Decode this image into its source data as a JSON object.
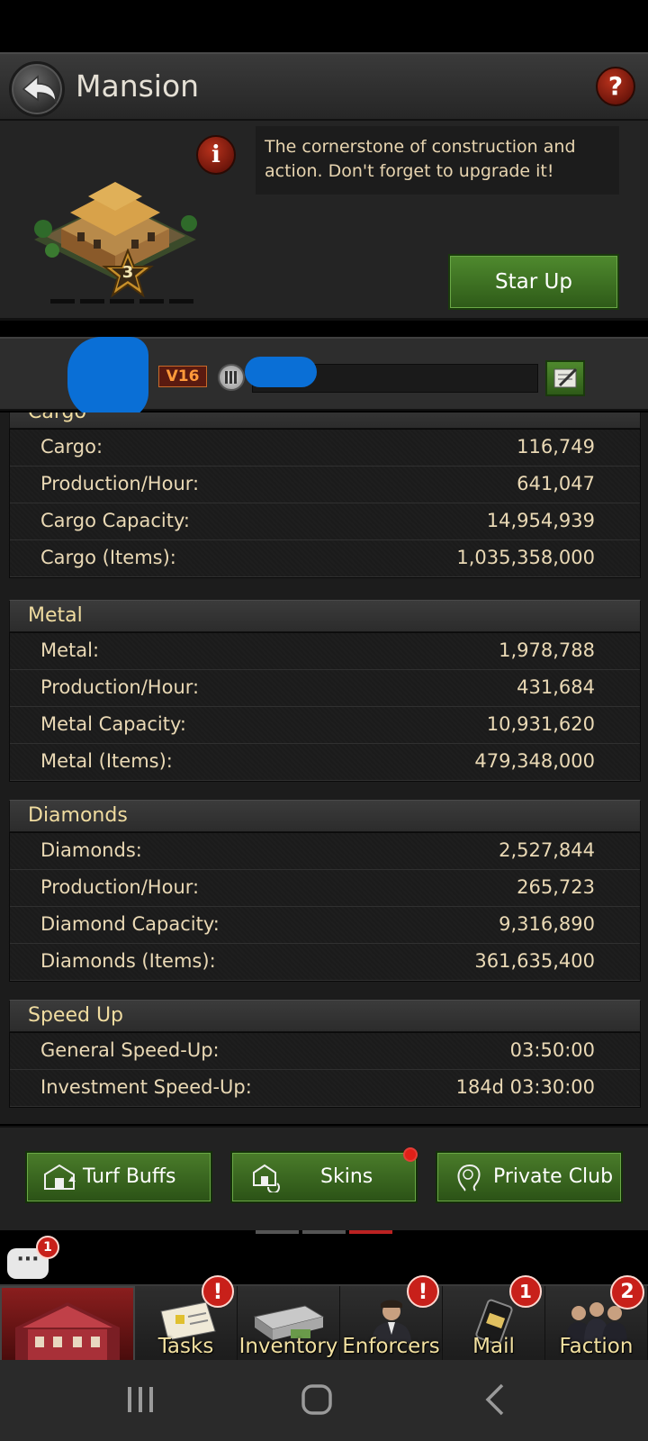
{
  "header": {
    "title": "Mansion",
    "help_label": "?"
  },
  "info": {
    "info_icon_label": "i",
    "description": "The cornerstone of construction and action. Don't forget to upgrade it!",
    "star_level": "3",
    "star_up_label": "Star Up"
  },
  "player": {
    "vip_label": "V16"
  },
  "sections": [
    {
      "title": "Cargo",
      "rows": [
        {
          "label": "Cargo:",
          "value": "116,749"
        },
        {
          "label": "Production/Hour:",
          "value": "641,047"
        },
        {
          "label": "Cargo Capacity:",
          "value": "14,954,939"
        },
        {
          "label": "Cargo (Items):",
          "value": "1,035,358,000"
        }
      ]
    },
    {
      "title": "Metal",
      "rows": [
        {
          "label": "Metal:",
          "value": "1,978,788"
        },
        {
          "label": "Production/Hour:",
          "value": "431,684"
        },
        {
          "label": "Metal Capacity:",
          "value": "10,931,620"
        },
        {
          "label": "Metal (Items):",
          "value": "479,348,000"
        }
      ]
    },
    {
      "title": "Diamonds",
      "rows": [
        {
          "label": "Diamonds:",
          "value": "2,527,844"
        },
        {
          "label": "Production/Hour:",
          "value": "265,723"
        },
        {
          "label": "Diamond Capacity:",
          "value": "9,316,890"
        },
        {
          "label": "Diamonds (Items):",
          "value": "361,635,400"
        }
      ]
    },
    {
      "title": "Speed Up",
      "rows": [
        {
          "label": "General Speed-Up:",
          "value": "03:50:00"
        },
        {
          "label": "Investment Speed-Up:",
          "value": "184d 03:30:00"
        }
      ]
    }
  ],
  "actions": {
    "turf_buffs": "Turf Buffs",
    "skins": "Skins",
    "private_club": "Private Club"
  },
  "chat": {
    "badge": "1"
  },
  "nav": [
    {
      "label": "",
      "badge": ""
    },
    {
      "label": "Tasks",
      "badge": "!"
    },
    {
      "label": "Inventory",
      "badge": ""
    },
    {
      "label": "Enforcers",
      "badge": "!"
    },
    {
      "label": "Mail",
      "badge": "1"
    },
    {
      "label": "Faction",
      "badge": "2"
    }
  ],
  "colors": {
    "accent_green": "#3e6e22",
    "badge_red": "#c8201a",
    "text_gold": "#f0dca0"
  }
}
